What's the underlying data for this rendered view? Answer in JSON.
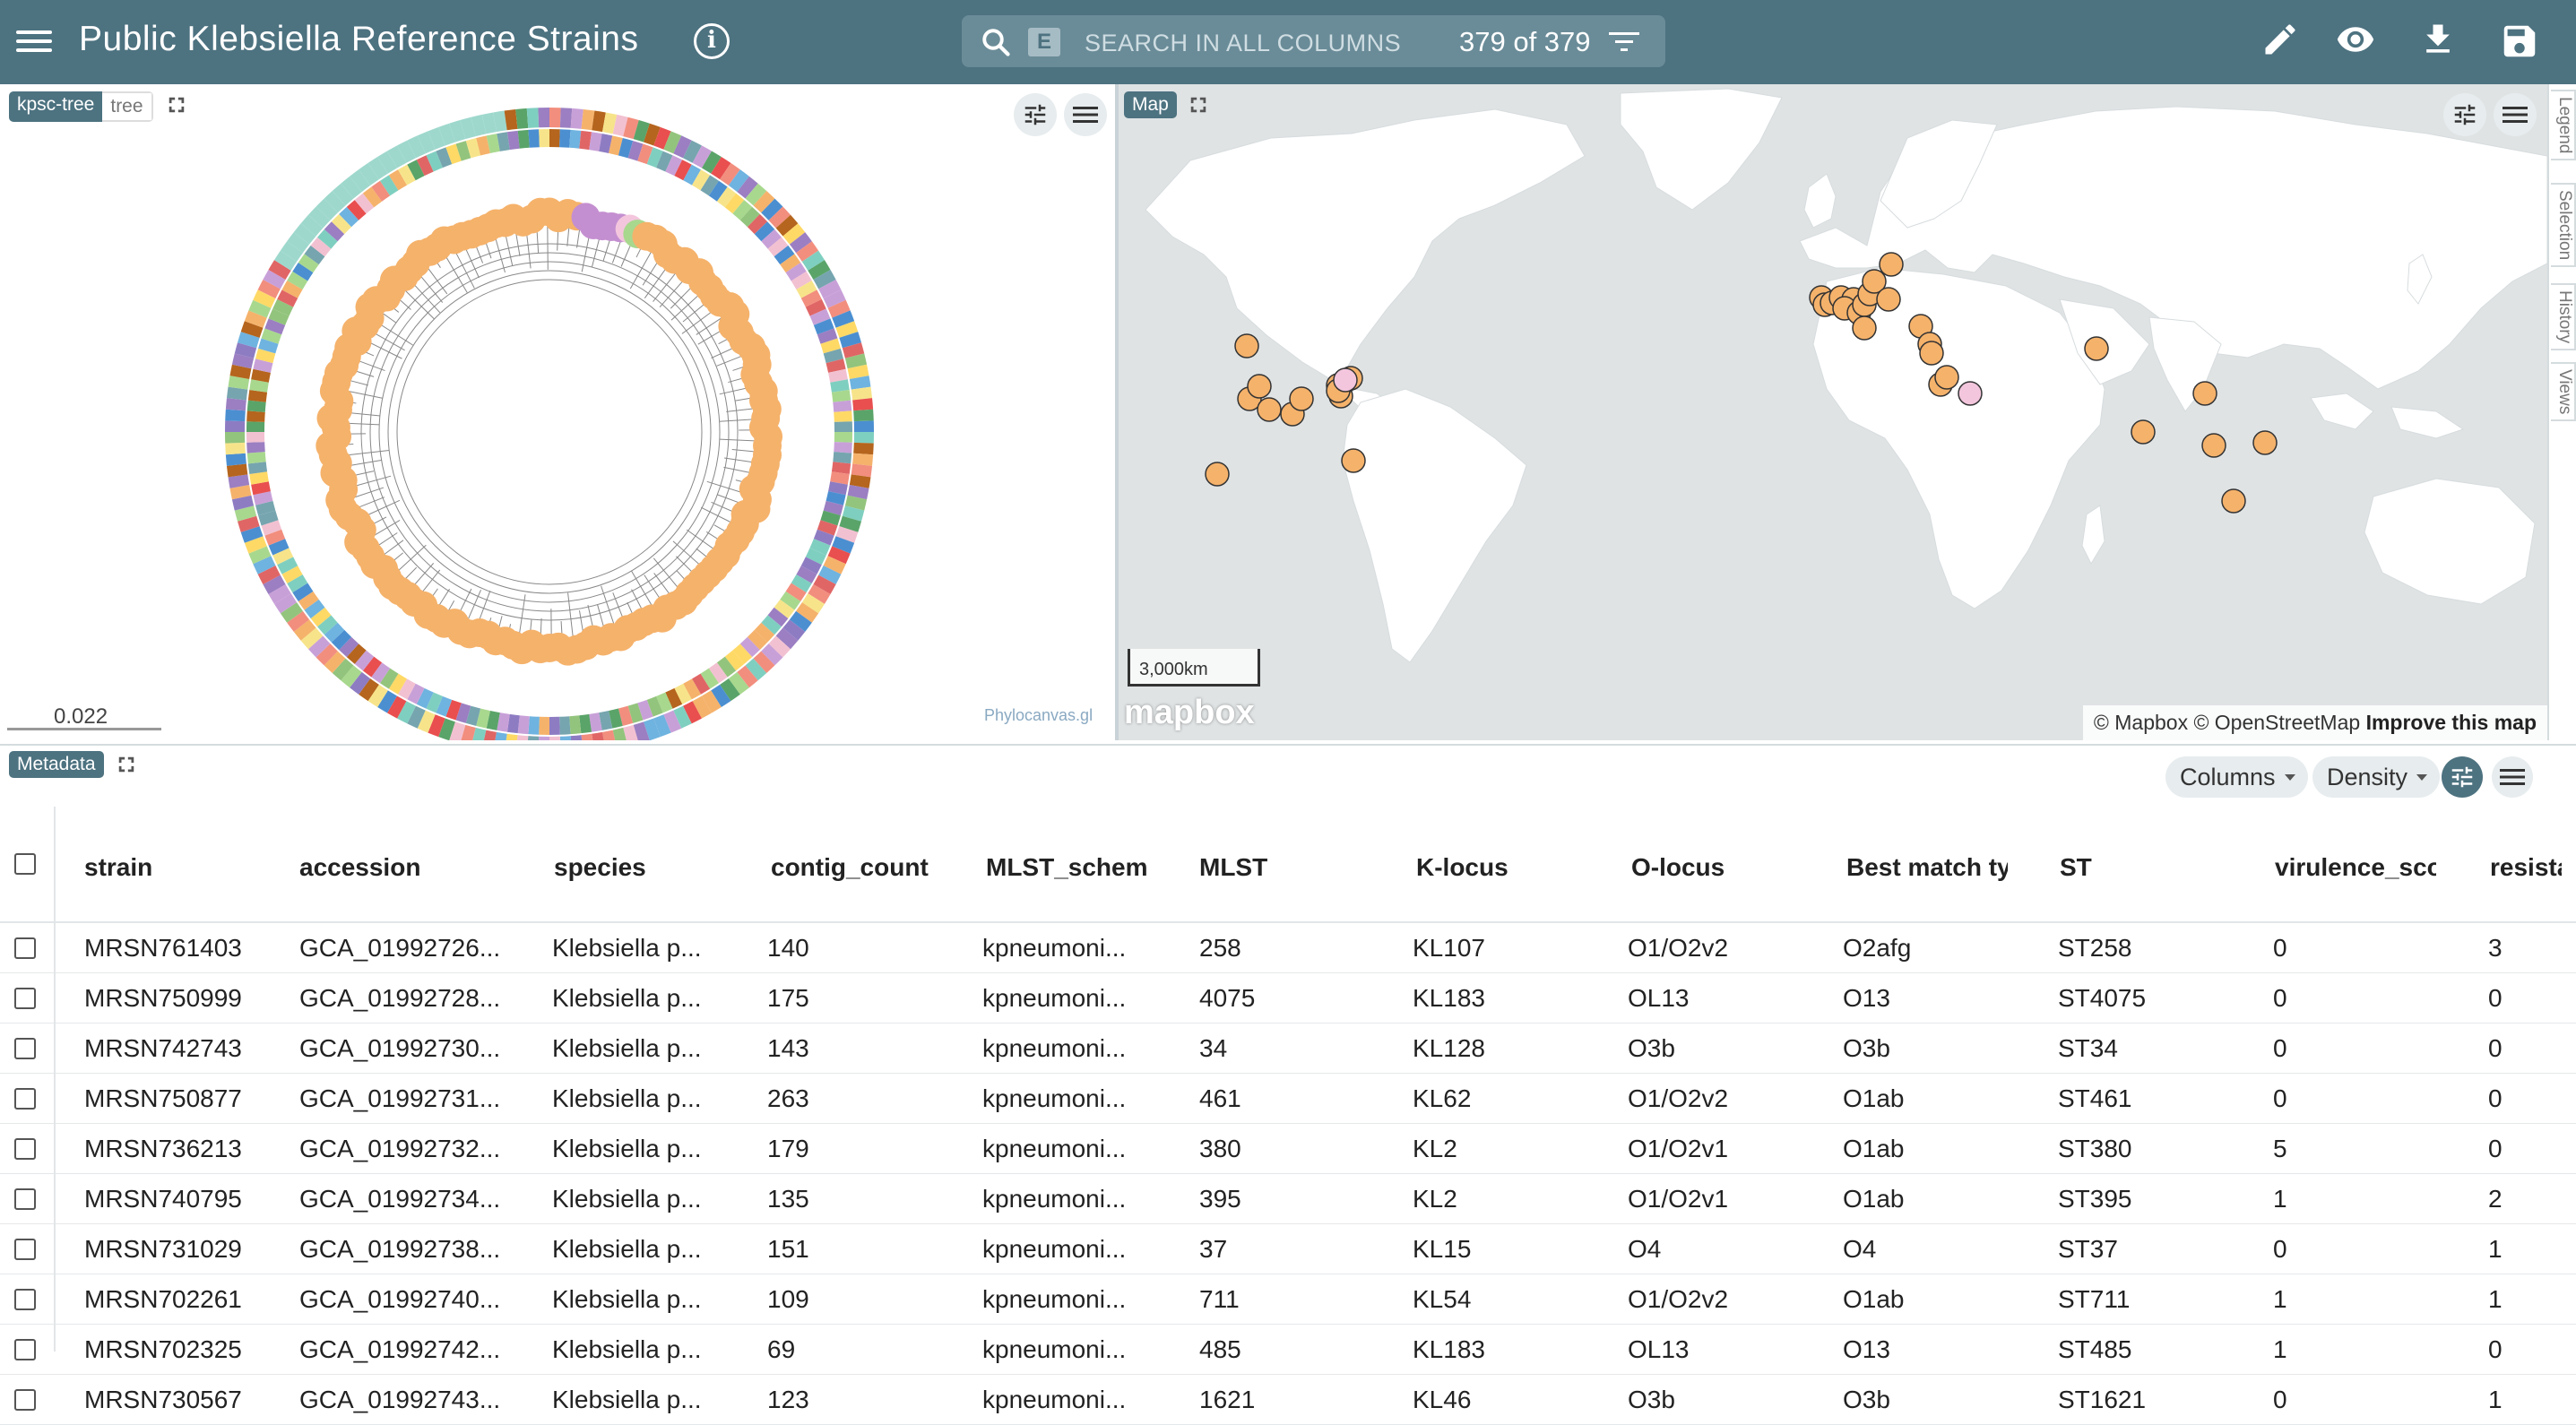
{
  "header": {
    "title": "Public Klebsiella Reference Strains",
    "search_badge": "E",
    "search_placeholder": "SEARCH IN ALL COLUMNS",
    "count": "379 of 379"
  },
  "tree_panel": {
    "tag_active": "kpsc-tree",
    "tag_inactive": "tree",
    "scale_value": "0.022",
    "logo_text": "Phylocanvas.gl"
  },
  "map_panel": {
    "tag": "Map",
    "scale": "3,000km",
    "logo": "mapbox",
    "attribution_1": "© Mapbox © OpenStreetMap",
    "attribution_2": "Improve this map",
    "land_color": "#ffffff",
    "water_color": "#dfe3e4",
    "marker_color": "#f5b26b",
    "marker_alt_color": "#f3c6dd"
  },
  "side_tabs": [
    "Legend",
    "Selection",
    "History",
    "Views"
  ],
  "table": {
    "tag": "Metadata",
    "columns_button": "Columns",
    "density_button": "Density",
    "headers": [
      "strain",
      "accession",
      "species",
      "contig_count",
      "MLST_scheme",
      "MLST",
      "K-locus",
      "O-locus",
      "Best match type",
      "ST",
      "virulence_score",
      "resistance_score"
    ],
    "rows": [
      [
        "MRSN761403",
        "GCA_01992726...",
        "Klebsiella p...",
        "140",
        "kpneumoni...",
        "258",
        "KL107",
        "O1/O2v2",
        "O2afg",
        "ST258",
        "0",
        "3"
      ],
      [
        "MRSN750999",
        "GCA_01992728...",
        "Klebsiella p...",
        "175",
        "kpneumoni...",
        "4075",
        "KL183",
        "OL13",
        "O13",
        "ST4075",
        "0",
        "0"
      ],
      [
        "MRSN742743",
        "GCA_01992730...",
        "Klebsiella p...",
        "143",
        "kpneumoni...",
        "34",
        "KL128",
        "O3b",
        "O3b",
        "ST34",
        "0",
        "0"
      ],
      [
        "MRSN750877",
        "GCA_01992731...",
        "Klebsiella p...",
        "263",
        "kpneumoni...",
        "461",
        "KL62",
        "O1/O2v2",
        "O1ab",
        "ST461",
        "0",
        "0"
      ],
      [
        "MRSN736213",
        "GCA_01992732...",
        "Klebsiella p...",
        "179",
        "kpneumoni...",
        "380",
        "KL2",
        "O1/O2v1",
        "O1ab",
        "ST380",
        "5",
        "0"
      ],
      [
        "MRSN740795",
        "GCA_01992734...",
        "Klebsiella p...",
        "135",
        "kpneumoni...",
        "395",
        "KL2",
        "O1/O2v1",
        "O1ab",
        "ST395",
        "1",
        "2"
      ],
      [
        "MRSN731029",
        "GCA_01992738...",
        "Klebsiella p...",
        "151",
        "kpneumoni...",
        "37",
        "KL15",
        "O4",
        "O4",
        "ST37",
        "0",
        "1"
      ],
      [
        "MRSN702261",
        "GCA_01992740...",
        "Klebsiella p...",
        "109",
        "kpneumoni...",
        "711",
        "KL54",
        "O1/O2v2",
        "O1ab",
        "ST711",
        "1",
        "1"
      ],
      [
        "MRSN702325",
        "GCA_01992742...",
        "Klebsiella p...",
        "69",
        "kpneumoni...",
        "485",
        "KL183",
        "OL13",
        "O13",
        "ST485",
        "1",
        "0"
      ],
      [
        "MRSN730567",
        "GCA_01992743...",
        "Klebsiella p...",
        "123",
        "kpneumoni...",
        "1621",
        "KL46",
        "O3b",
        "O3b",
        "ST1621",
        "0",
        "1"
      ]
    ]
  }
}
